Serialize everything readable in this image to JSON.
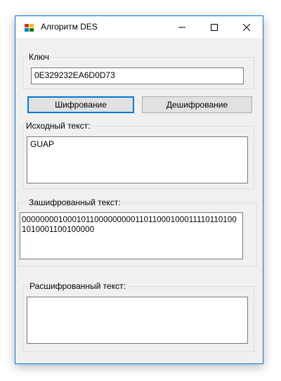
{
  "window": {
    "title": "Алгоритм DES"
  },
  "key_group": {
    "label": "Ключ",
    "value": "0E329232EA6D0D73"
  },
  "buttons": {
    "encrypt": "Шифрование",
    "decrypt": "Дешифрование"
  },
  "source_group": {
    "label": "Исходный текст:",
    "value": "GUAP"
  },
  "encrypted_group": {
    "label": "Зашифрованный текст:",
    "value": "0000000010001011000000000110110001000111101101001010001100100000"
  },
  "decrypted_group": {
    "label": "Расшифрованный текст:",
    "value": ""
  },
  "colors": {
    "accent": "#0078d7",
    "window_bg": "#f0f0f0",
    "button_bg": "#e1e1e1"
  }
}
